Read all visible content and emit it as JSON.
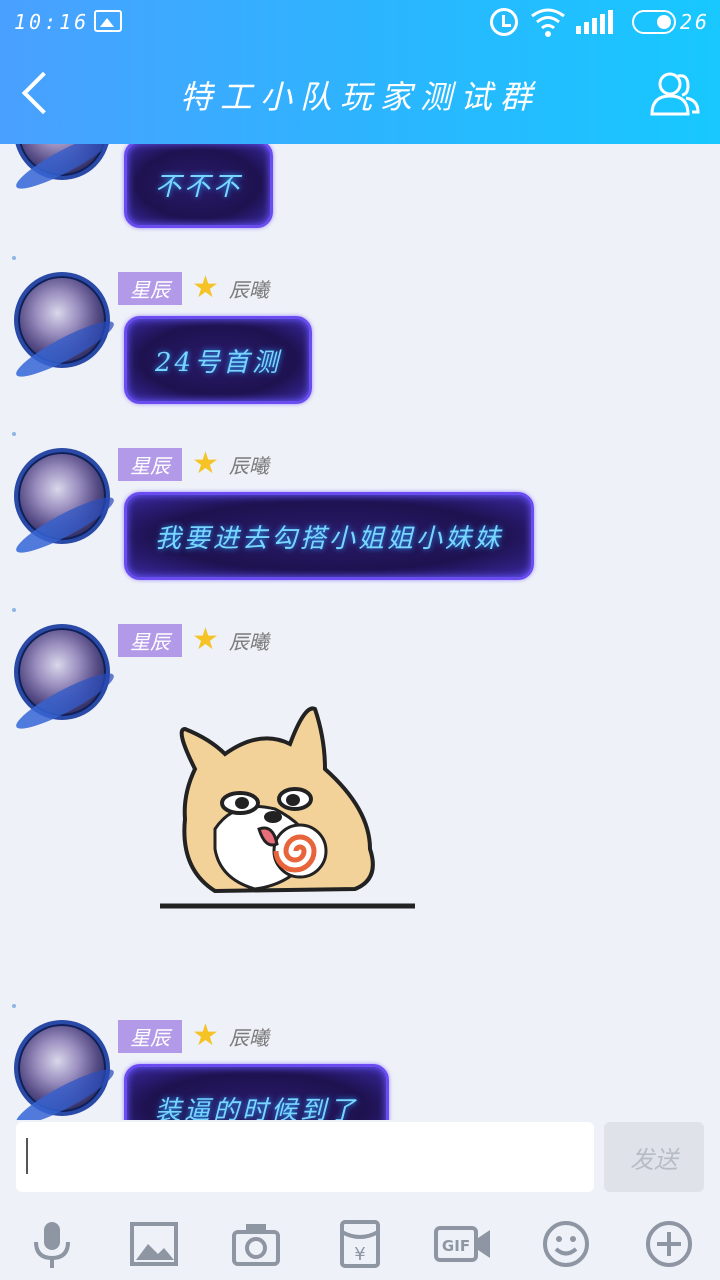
{
  "status_bar": {
    "time": "10:16",
    "battery": "26"
  },
  "header": {
    "title": "特工小队玩家测试群"
  },
  "messages": [
    {
      "text": "不不不"
    },
    {
      "tag": "星辰",
      "nick": "辰曦",
      "text": "24号首测"
    },
    {
      "tag": "星辰",
      "nick": "辰曦",
      "text": "我要进去勾搭小姐姐小妹妹"
    },
    {
      "tag": "星辰",
      "nick": "辰曦"
    },
    {
      "tag": "星辰",
      "nick": "辰曦",
      "text": "装逼的时候到了"
    }
  ],
  "composer": {
    "input_value": "",
    "send_label": "发送"
  },
  "toolbar": {
    "icons": [
      "mic-icon",
      "image-icon",
      "camera-icon",
      "red-packet-icon",
      "gif-icon",
      "emoji-icon",
      "plus-icon"
    ]
  },
  "colors": {
    "header_start": "#4aa0ff",
    "header_end": "#18c8ff",
    "tag_bg": "#b39ae8",
    "bubble_border": "#6a4cf0",
    "bubble_text": "#78d6ff"
  }
}
